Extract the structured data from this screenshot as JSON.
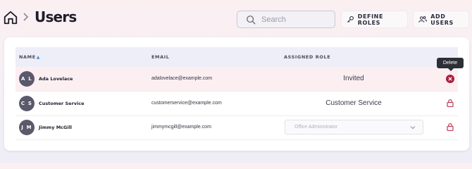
{
  "header": {
    "title": "Users",
    "home_icon": "home-icon",
    "separator_icon": "chevron-right-icon"
  },
  "search": {
    "placeholder": "Search",
    "icon": "search-icon"
  },
  "actions": {
    "define_roles": {
      "label": "DEFINE ROLES",
      "icon": "key-icon"
    },
    "add_users": {
      "label": "ADD USERS",
      "icon": "users-icon"
    }
  },
  "table": {
    "columns": {
      "name": "NAME",
      "email": "EMAIL",
      "role": "ASSIGNED ROLE"
    },
    "sort": {
      "column": "name",
      "direction": "ascending"
    },
    "rows": [
      {
        "initials": "A L",
        "name": "Ada Lovelace",
        "email": "adalovelace@example.com",
        "role": "Invited",
        "action_icon": "delete-icon"
      },
      {
        "initials": "C S",
        "name": "Customer Service",
        "email": "customerservice@example.com",
        "role": "Customer Service",
        "action_icon": "lock-icon"
      },
      {
        "initials": "J M",
        "name": "Jimmy McGill",
        "email": "jimmymcgill@example.com",
        "role_select": {
          "placeholder": "Office Administrator"
        },
        "action_icon": "lock-icon"
      }
    ]
  },
  "tooltip": {
    "text": "Delete"
  },
  "colors": {
    "avatar": "#5a5a6c",
    "delete": "#a8203c",
    "lock": "#c23a56",
    "header_row": "#eeeef8",
    "highlight_row": "#fbeff2"
  }
}
